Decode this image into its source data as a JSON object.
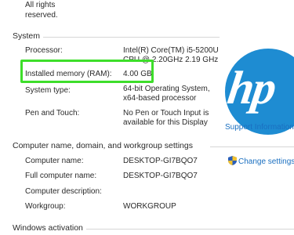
{
  "top": {
    "line1": "All rights",
    "line2": "reserved."
  },
  "system": {
    "heading": "System",
    "processor_label": "Processor:",
    "processor_value_1": "Intel(R) Core(TM) i5-5200U",
    "processor_value_2": "CPU @ 2.20GHz   2.19 GHz",
    "ram_label": "Installed memory (RAM):",
    "ram_value": "4.00 GB",
    "type_label": "System type:",
    "type_value_1": "64-bit Operating System,",
    "type_value_2": "x64-based processor",
    "pen_label": "Pen and Touch:",
    "pen_value_1": "No Pen or Touch Input is",
    "pen_value_2": "available for this Display"
  },
  "logo": {
    "text": "hp",
    "color": "#1e8cd2"
  },
  "support_link": "Support Information",
  "computer": {
    "heading": "Computer name, domain, and workgroup settings",
    "change_settings": "Change settings",
    "name_label": "Computer name:",
    "name_value": "DESKTOP-GI7BQO7",
    "full_label": "Full computer name:",
    "full_value": "DESKTOP-GI7BQO7",
    "desc_label": "Computer description:",
    "desc_value": "",
    "workgroup_label": "Workgroup:",
    "workgroup_value": "WORKGROUP"
  },
  "activation": {
    "heading": "Windows activation"
  },
  "colors": {
    "highlight": "#3dde2a",
    "link": "#1a6fc0"
  }
}
